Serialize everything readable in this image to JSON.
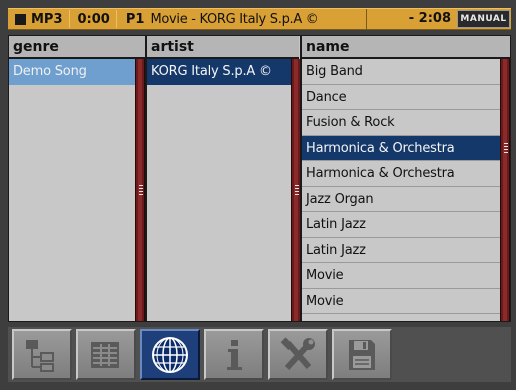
{
  "statusbar": {
    "format": "MP3",
    "time": "0:00",
    "slot": "P1",
    "song": "Movie - KORG Italy S.p.A ©",
    "remaining": "- 2:08",
    "mode_button": "MANUAL"
  },
  "columns": {
    "genre": {
      "header": "genre",
      "items": [
        "Demo Song"
      ],
      "selected_index": 0
    },
    "artist": {
      "header": "artist",
      "items": [
        "KORG Italy S.p.A ©"
      ],
      "selected_index": 0
    },
    "name": {
      "header": "name",
      "items": [
        "Big Band",
        "Dance",
        "Fusion & Rock",
        "Harmonica & Orchestra",
        "Harmonica & Orchestra",
        "Jazz Organ",
        "Latin Jazz",
        "Latin Jazz",
        "Movie",
        "Movie"
      ],
      "selected_index": 3
    }
  },
  "toolbar": {
    "buttons": [
      {
        "icon": "folder-tree-icon",
        "active": false
      },
      {
        "icon": "list-view-icon",
        "active": false
      },
      {
        "icon": "globe-icon",
        "active": true
      },
      {
        "icon": "info-icon",
        "active": false
      },
      {
        "icon": "tools-icon",
        "active": false
      },
      {
        "icon": "save-disk-icon",
        "active": false
      }
    ]
  },
  "colors": {
    "status_bar": "#d9a035",
    "selection_light": "#6f9fcf",
    "selection_dark": "#15386a",
    "scrollbar": "#6a1a1a",
    "active_button": "#1f3f7a"
  }
}
